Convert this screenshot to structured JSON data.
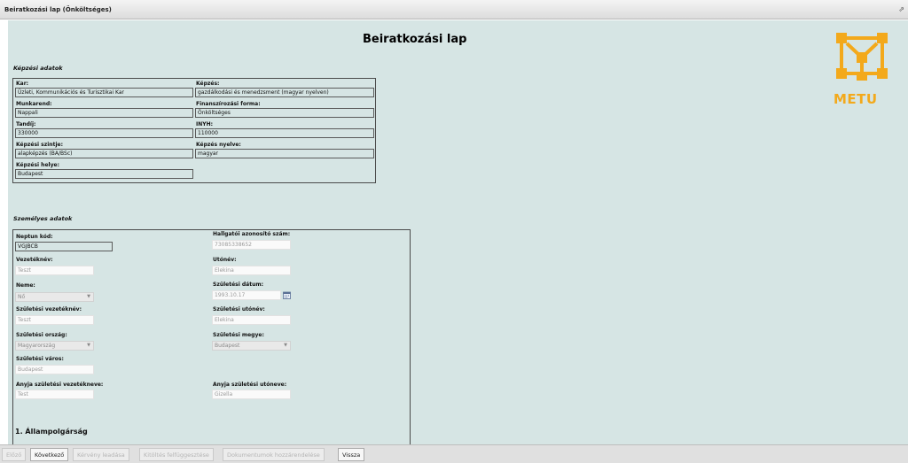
{
  "window": {
    "title": "Beiratkozási lap (Önköltséges)",
    "restore_glyph": "⇗"
  },
  "page": {
    "title": "Beiratkozási lap"
  },
  "logo": {
    "text": "METU",
    "color": "#f3a91b"
  },
  "kepzesi": {
    "section_title": "Képzési adatok",
    "kar": {
      "label": "Kar:",
      "value": "Üzleti, Kommunikációs és Turisztikai Kar"
    },
    "kepzes": {
      "label": "Képzés:",
      "value": "gazdálkodási és menedzsment (magyar nyelven)"
    },
    "munkarend": {
      "label": "Munkarend:",
      "value": "Nappali"
    },
    "finanszirozas": {
      "label": "Finanszírozási forma:",
      "value": "Önköltséges"
    },
    "tandij": {
      "label": "Tandíj:",
      "value": "330000"
    },
    "inyh": {
      "label": "INYH:",
      "value": "110000"
    },
    "szint": {
      "label": "Képzési szintje:",
      "value": "alapképzés (BA/BSc)"
    },
    "nyelv": {
      "label": "Képzés nyelve:",
      "value": "magyar"
    },
    "hely": {
      "label": "Képzési helye:",
      "value": "Budapest"
    }
  },
  "szemelyes": {
    "section_title": "Személyes adatok",
    "neptun": {
      "label": "Neptun kód:",
      "value": "VGJBCB"
    },
    "hallgatoi": {
      "label": "Hallgatói azonosító szám:",
      "value": "73085338652"
    },
    "vezeteknev": {
      "label": "Vezetéknév:",
      "value": "Teszt"
    },
    "utonev": {
      "label": "Utónév:",
      "value": "Elekina"
    },
    "neme": {
      "label": "Neme:",
      "value": "Nő"
    },
    "szuletesi_datum": {
      "label": "Születési dátum:",
      "value": "1993.10.17"
    },
    "szul_vezeteknev": {
      "label": "Születési vezetéknév:",
      "value": "Teszt"
    },
    "szul_utonev": {
      "label": "Születési utónév:",
      "value": "Elekina"
    },
    "szul_orszag": {
      "label": "Születési ország:",
      "value": "Magyarország"
    },
    "szul_megye": {
      "label": "Születési megye:",
      "value": "Budapest"
    },
    "szul_varos": {
      "label": "Születési város:",
      "value": "Budapest"
    },
    "anyja_vezeteknev": {
      "label": "Anyja születési vezetékneve:",
      "value": "Test"
    },
    "anyja_utonev": {
      "label": "Anyja születési utóneve:",
      "value": "Gizella"
    },
    "allampolgarsag": "1. Állampolgárság"
  },
  "footer": {
    "elozo": "Előző",
    "kovetkezo": "Következő",
    "kerveny": "Kérvény leadása",
    "kitoltes": "Kitöltés felfüggesztése",
    "dokumentumok": "Dokumentumok hozzárendelése",
    "vissza": "Vissza"
  }
}
